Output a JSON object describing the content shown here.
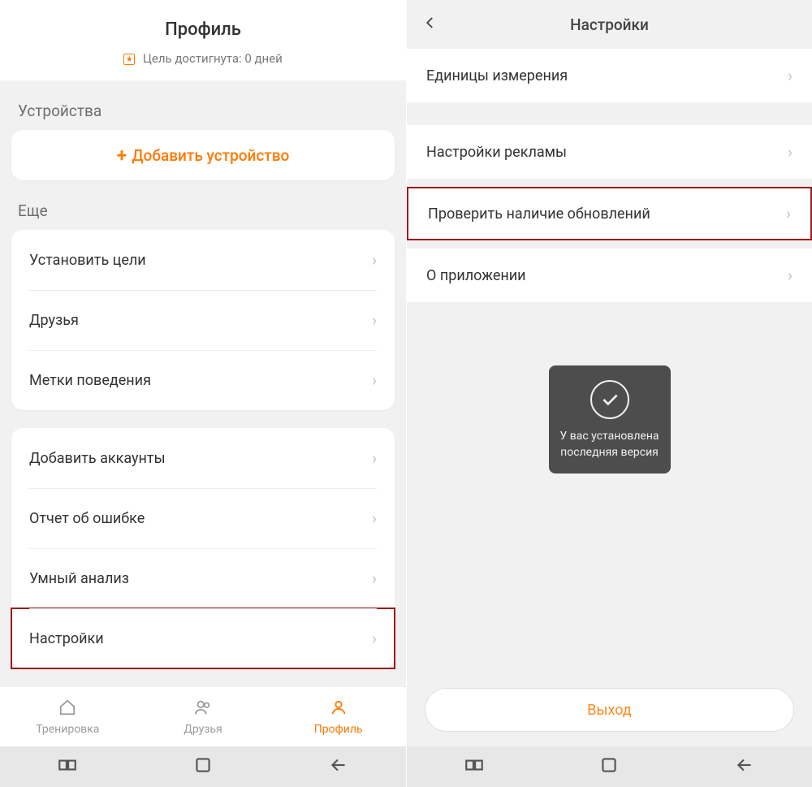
{
  "left": {
    "header_title": "Профиль",
    "goal_text": "Цель достигнута: 0 дней",
    "badge_glyph": "★",
    "devices_label": "Устройства",
    "add_device": "Добавить устройство",
    "more_label": "Еще",
    "group1": [
      "Установить цели",
      "Друзья",
      "Метки поведения"
    ],
    "group2": [
      "Добавить аккаунты",
      "Отчет об ошибке",
      "Умный анализ",
      "Настройки"
    ],
    "tabs": [
      {
        "label": "Тренировка"
      },
      {
        "label": "Друзья"
      },
      {
        "label": "Профиль"
      }
    ]
  },
  "right": {
    "header_title": "Настройки",
    "rows": {
      "units": "Единицы измерения",
      "ads": "Настройки рекламы",
      "updates": "Проверить наличие обновлений",
      "about": "О приложении"
    },
    "toast": "У вас установлена последняя версия",
    "logout": "Выход"
  }
}
